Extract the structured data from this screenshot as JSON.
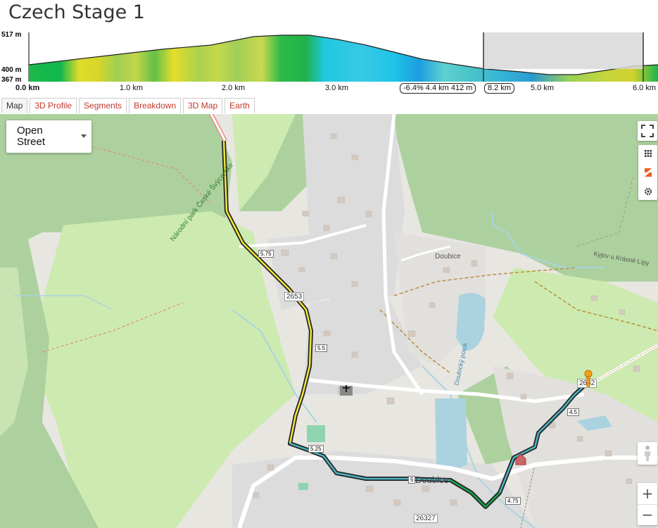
{
  "title": "Czech Stage 1",
  "profile": {
    "y_max_label": "517 m",
    "y_mid_label": "400 m",
    "y_min_label": "367 m",
    "x_labels": [
      "0.0 km",
      "1.0 km",
      "2.0 km",
      "3.0 km",
      "5.0 km",
      "6.0 km"
    ],
    "cursor_readout": "-6.4% 4.4 km 412 m",
    "selection_length": "8.2 km"
  },
  "tabs": [
    {
      "label": "Map"
    },
    {
      "label": "3D Profile"
    },
    {
      "label": "Segments"
    },
    {
      "label": "Breakdown"
    },
    {
      "label": "3D Map"
    },
    {
      "label": "Earth"
    }
  ],
  "map": {
    "layer_selector": "Open Street",
    "labels": {
      "park": "Národní park České Švýcarsko",
      "village": "Doubice",
      "village_big": "Doubice",
      "stream": "Doubický potok",
      "place": "Kyjov u Krásné Lípy",
      "road1": "2653",
      "road2": "26327",
      "road3": "2652"
    },
    "km_markers": [
      "5.75",
      "5.5",
      "5.25",
      "5",
      "4.75",
      "4.5"
    ]
  },
  "colors": {
    "route_fill_a": "#f0e63a",
    "route_fill_b": "#4bb5c2",
    "route_fill_c": "#19a34a",
    "forest": "#add19e",
    "meadow": "#cdebb0",
    "water": "#aad3df",
    "residential": "#e0dfdf",
    "tab_text": "#c0392b"
  },
  "icons": [
    "fullscreen-icon",
    "grid-icon",
    "strava-icon",
    "gear-icon",
    "pegman-icon",
    "zoom-in-icon",
    "zoom-out-icon",
    "caret-down-icon",
    "pin-icon",
    "church-icon"
  ]
}
